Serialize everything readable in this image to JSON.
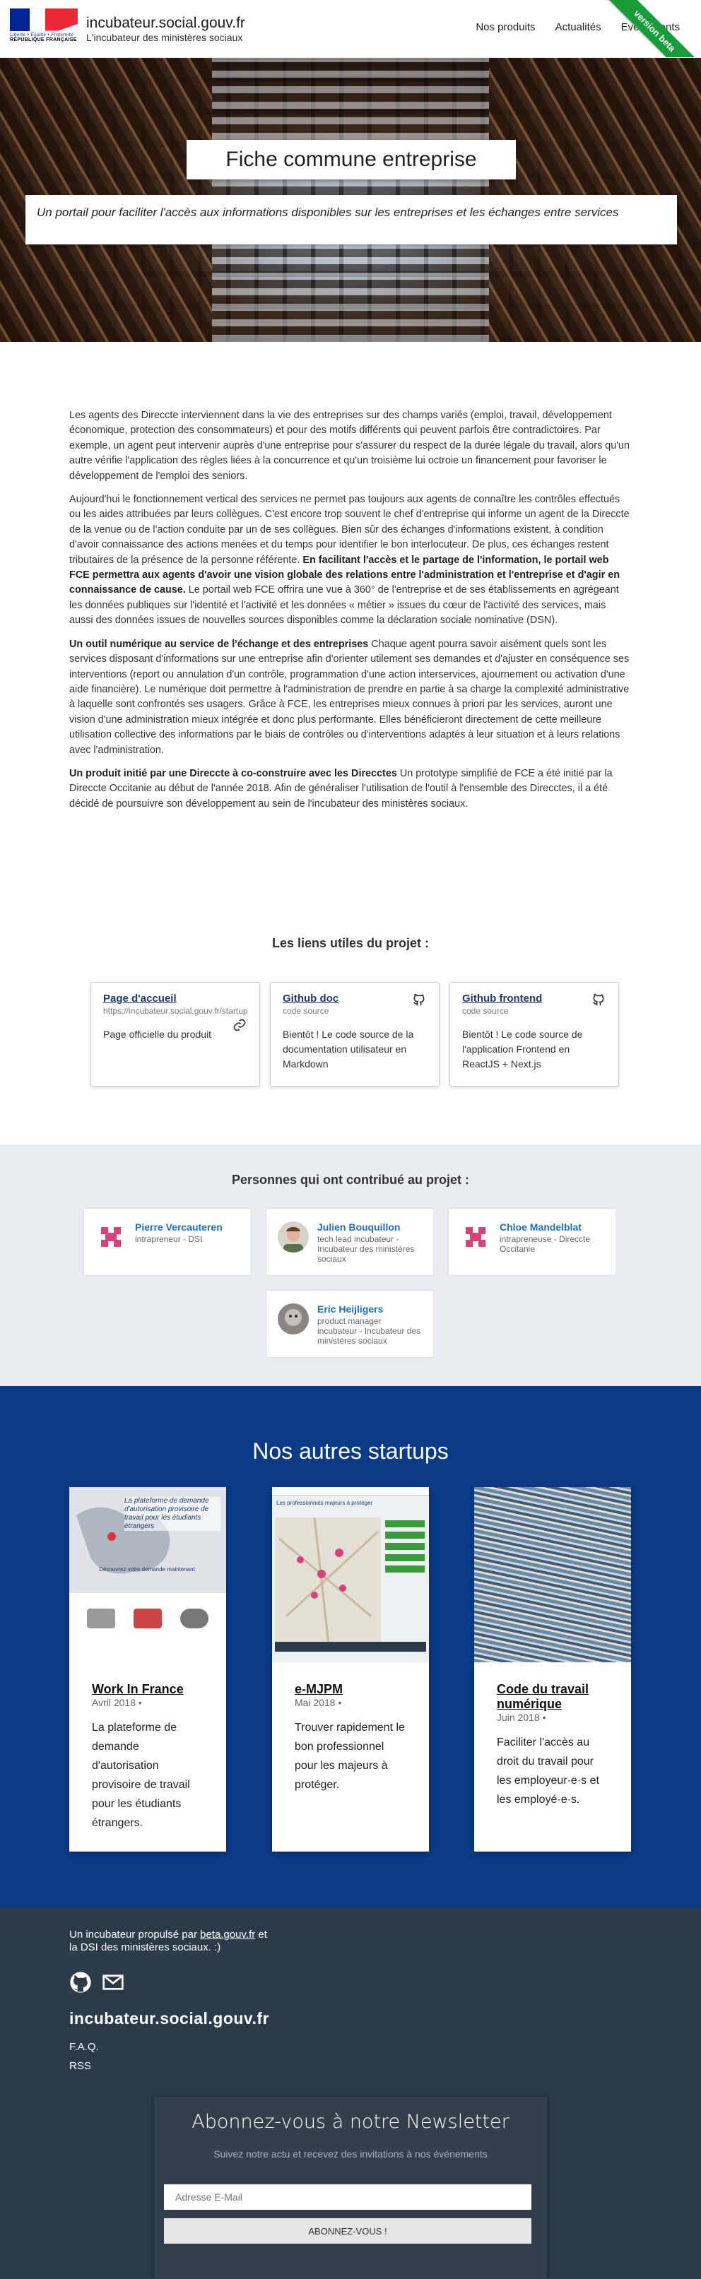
{
  "header": {
    "marianne_motto": "Liberté • Égalité • Fraternité",
    "marianne_label": "RÉPUBLIQUE FRANÇAISE",
    "site_title": "incubateur.social.gouv.fr",
    "site_subtitle": "L'incubateur des ministères sociaux",
    "nav": [
      "Nos produits",
      "Actualités",
      "Evénements"
    ],
    "ribbon": "version beta"
  },
  "hero": {
    "title": "Fiche commune entreprise",
    "lead": "Un portail pour faciliter l'accès aux informations disponibles sur les entreprises et les échanges entre services"
  },
  "content": {
    "p1": "Les agents des Direccte interviennent dans la vie des entreprises sur des champs variés (emploi, travail, développement économique, protection des consommateurs) et pour des motifs différents qui peuvent parfois être contradictoires. Par exemple, un agent peut intervenir auprès d'une entreprise pour s'assurer du respect de la durée légale du travail, alors qu'un autre vérifie l'application des règles liées à la concurrence et qu'un troisième lui octroie un financement pour favoriser le développement de l'emploi des seniors.",
    "p2a": "Aujourd'hui le fonctionnement vertical des services ne permet pas toujours aux agents de connaître les contrôles effectués ou les aides attribuées par leurs collègues. C'est encore trop souvent le chef d'entreprise qui informe un agent de la Direccte de la venue ou de l'action conduite par un de ses collègues. Bien sûr des échanges d'informations existent, à condition d'avoir connaissance des actions menées et du temps pour identifier le bon interlocuteur. De plus, ces échanges restent tributaires de la présence de la personne référente.",
    "p2b": "En facilitant l'accès et le partage de l'information, le portail web FCE permettra aux agents d'avoir une vision globale des relations entre l'administration et l'entreprise et d'agir en connaissance de cause.",
    "p2c": "Le portail web FCE offrira une vue à 360° de l'entreprise et de ses établissements en agrégeant les données publiques sur l'identité et l'activité et les données « métier » issues du cœur de l'activité des services, mais aussi des données issues de nouvelles sources disponibles comme la déclaration sociale nominative (DSN).",
    "p3a": "Un outil numérique au service de l'échange et des entreprises",
    "p3b": "Chaque agent pourra savoir aisément quels sont les services disposant d'informations sur une entreprise afin d'orienter utilement ses demandes et d'ajuster en conséquence ses interventions (report ou annulation d'un contrôle, programmation d'une action interservices, ajournement ou activation d'une aide financière). Le numérique doit permettre à l'administration de prendre en partie à sa charge la complexité administrative à laquelle sont confrontés ses usagers. Grâce à FCE, les entreprises mieux connues à priori par les services, auront une vision d'une administration mieux intégrée et donc plus performante. Elles bénéficieront directement de cette meilleure utilisation collective des informations par le biais de contrôles ou d'interventions adaptés à leur situation et à leurs relations avec l'administration.",
    "p4a": "Un produit initié par une Direccte à co-construire avec les Direcctes",
    "p4b": "Un prototype simplifié de FCE a été initié par la Direccte Occitanie au début de l'année 2018. Afin de généraliser l'utilisation de l'outil à l'ensemble des Direcctes, il a été décidé de poursuivre son développement au sein de l'incubateur des ministères sociaux."
  },
  "links": {
    "title": "Les liens utiles du projet :",
    "items": [
      {
        "title": "Page d'accueil",
        "sub": "https://incubateur.social.gouv.fr/startups/",
        "desc": "Page officielle du produit",
        "icon": "link-icon"
      },
      {
        "title": "Github doc",
        "sub": "code source",
        "desc": "Bientôt ! Le code source de la documentation utilisateur en Markdown",
        "icon": "github-icon"
      },
      {
        "title": "Github frontend",
        "sub": "code source",
        "desc": "Bientôt ! Le code source de l'application Frontend en ReactJS + Next.js",
        "icon": "github-icon"
      }
    ]
  },
  "contributors": {
    "title": "Personnes qui ont contribué au projet :",
    "people": [
      {
        "name": "Pierre Vercauteren",
        "role": "intrapreneur - DSI"
      },
      {
        "name": "Julien Bouquillon",
        "role": "tech lead incubateur - Incubateur des ministères sociaux"
      },
      {
        "name": "Chloe Mandelblat",
        "role": "intrapreneuse - Direccte Occitanie"
      },
      {
        "name": "Eric Heijligers",
        "role": "product manager incubateur - Incubateur des ministères sociaux"
      }
    ]
  },
  "startups": {
    "title": "Nos autres startups",
    "items": [
      {
        "name": "Work In France",
        "date": "Avril 2018 •",
        "desc": "La plateforme de demande d'autorisation provisoire de travail pour les étudiants étrangers.",
        "banner": "La plateforme de demande d'autorisation provisoire de travail pour les étudiants étrangers",
        "btn": "Découvrez votre demande maintenant"
      },
      {
        "name": "e-MJPM",
        "date": "Mai 2018 •",
        "desc": "Trouver rapidement le bon professionnel pour les majeurs à protéger.",
        "banner": "Les professionnels majeurs à protéger"
      },
      {
        "name": "Code du travail numérique",
        "date": "Juin 2018 •",
        "desc": "Faciliter l'accès au droit du travail pour les employeur·e·s et les employé·e·s."
      }
    ]
  },
  "footer": {
    "tagline_pre": "Un incubateur propulsé par ",
    "tagline_link": "beta.gouv.fr",
    "tagline_post": " et",
    "tagline_line2": "la DSI des ministères sociaux. :)",
    "brand": "incubateur.social.gouv.fr",
    "links": [
      "F.A.Q.",
      "RSS"
    ],
    "newsletter": {
      "title": "Abonnez-vous à notre Newsletter",
      "subtitle": "Suivez notre actu et recevez des invitations à nos événements",
      "placeholder": "Adresse E-Mail",
      "button": "ABONNEZ-VOUS !"
    }
  },
  "colors": {
    "startups_bg": "#0b3a86",
    "footer_bg": "#2c3a49",
    "ribbon": "#1a9b3a",
    "contrib_bg": "#e9ecf1",
    "link_blue": "#1d6fc2"
  }
}
